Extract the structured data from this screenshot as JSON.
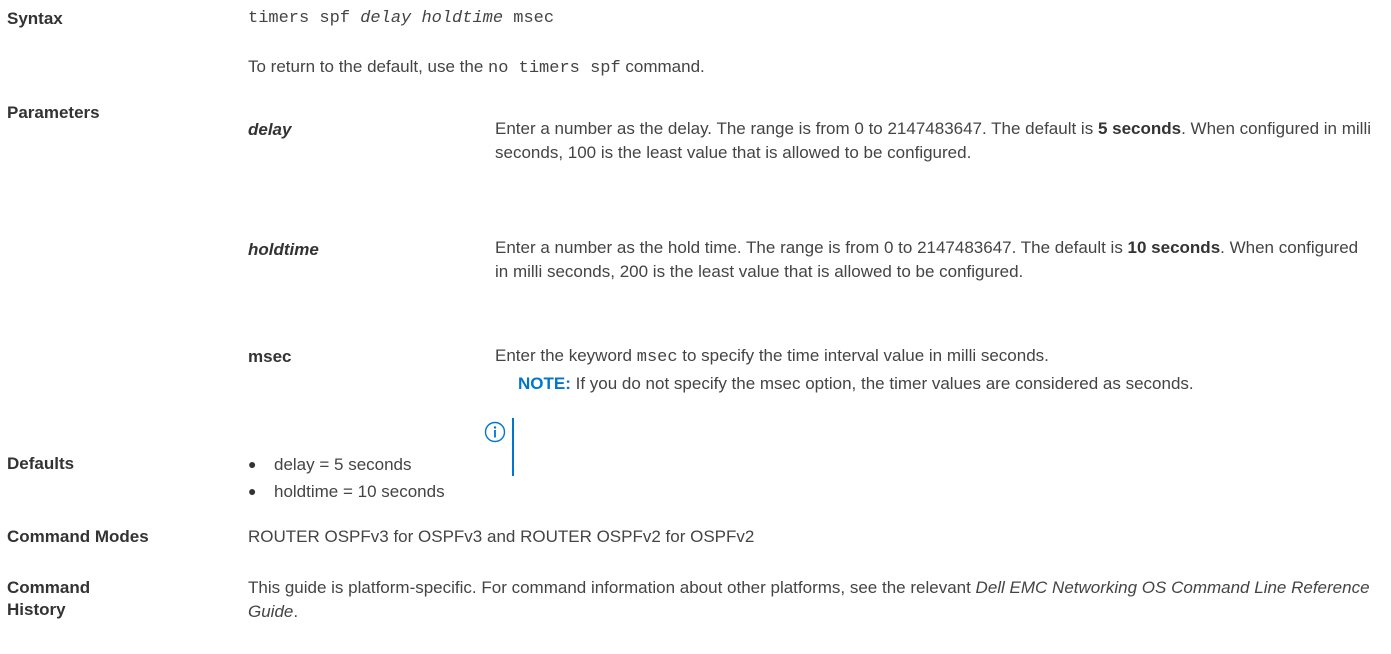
{
  "syntax": {
    "label": "Syntax",
    "cmd_prefix": "timers spf ",
    "cmd_delay": "delay",
    "cmd_space": " ",
    "cmd_holdtime": "holdtime",
    "cmd_suffix": " msec",
    "return_prefix": "To return to the default, use the ",
    "return_cmd": "no timers spf",
    "return_suffix": " command."
  },
  "parameters": {
    "label": "Parameters",
    "items": [
      {
        "name": "delay",
        "desc_before": "Enter a number as the delay. The range is from 0 to 2147483647. The default is ",
        "desc_bold": "5 seconds",
        "desc_after": ". When configured in milli seconds, 100 is the least value that is allowed to be configured."
      },
      {
        "name": "holdtime",
        "desc_before": "Enter a number as the hold time. The range is from 0 to 2147483647. The default is ",
        "desc_bold": "10 seconds",
        "desc_after": ". When configured in milli seconds, 200 is the least value that is allowed to be configured."
      },
      {
        "name": "msec",
        "desc_before": "Enter the keyword ",
        "desc_mono": "msec",
        "desc_after": " to specify the time interval value in milli seconds."
      }
    ],
    "note": {
      "label": "NOTE:",
      "text": " If you do not specify the msec option, the timer values are considered as seconds.",
      "icon": "info-icon",
      "color": "#0076ce"
    }
  },
  "defaults": {
    "label": "Defaults",
    "items": [
      "delay = 5 seconds",
      "holdtime = 10 seconds"
    ]
  },
  "command_modes": {
    "label": "Command Modes",
    "text": "ROUTER OSPFv3 for OSPFv3 and ROUTER OSPFv2 for OSPFv2"
  },
  "command_history": {
    "label_line1": "Command",
    "label_line2": "History",
    "text_before": "This guide is platform-specific. For command information about other platforms, see the relevant ",
    "text_italic": "Dell EMC Networking OS Command Line Reference Guide",
    "text_after": "."
  }
}
